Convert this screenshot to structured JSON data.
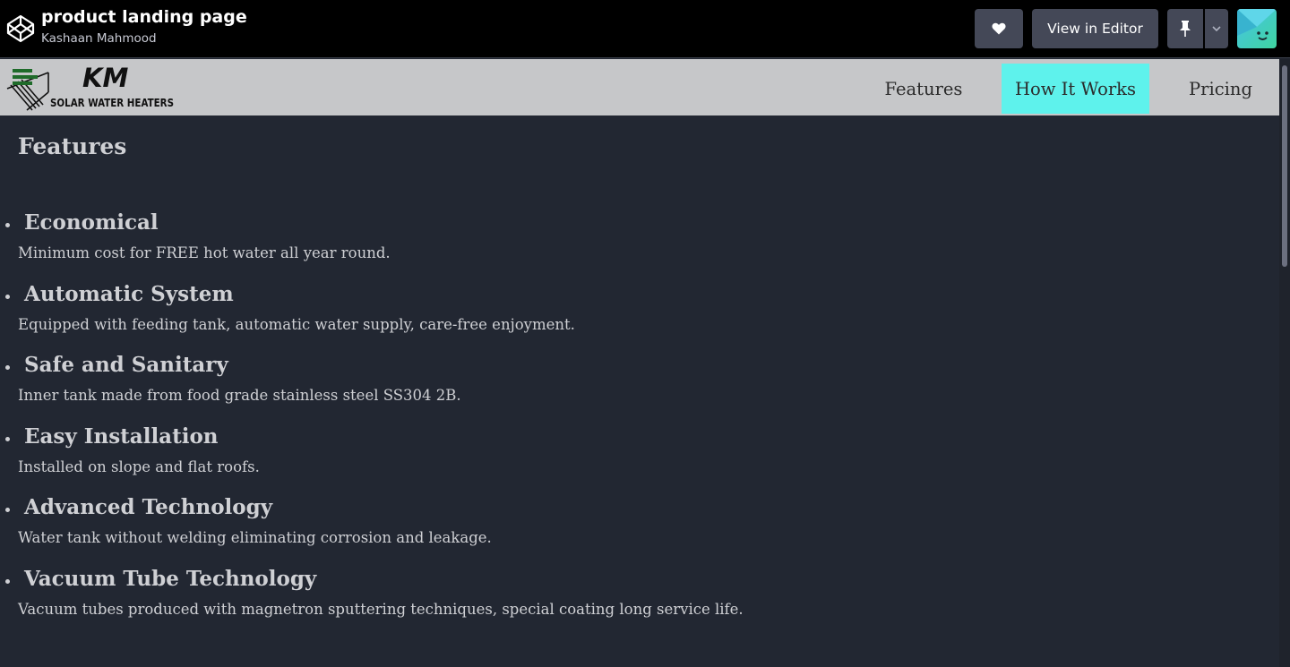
{
  "pen": {
    "title": "product landing page",
    "author": "Kashaan Mahmood",
    "view_in_editor_label": "View in Editor",
    "icons": {
      "logo": "codepen-logo-icon",
      "heart": "heart-icon",
      "pin": "pin-icon",
      "dropdown": "chevron-down-icon"
    }
  },
  "site": {
    "logo": {
      "brand": "KM",
      "tagline": "SOLAR WATER HEATERS"
    },
    "nav": [
      {
        "label": "Features"
      },
      {
        "label": "How It Works",
        "highlighted": true
      },
      {
        "label": "Pricing"
      }
    ],
    "features_title": "Features",
    "features": [
      {
        "heading": "Economical",
        "description": "Minimum cost for FREE hot water all year round."
      },
      {
        "heading": "Automatic System",
        "description": "Equipped with feeding tank, automatic water supply, care-free enjoyment."
      },
      {
        "heading": "Safe and Sanitary",
        "description": "Inner tank made from food grade stainless steel SS304 2B."
      },
      {
        "heading": "Easy Installation",
        "description": "Installed on slope and flat roofs."
      },
      {
        "heading": "Advanced Technology",
        "description": "Water tank without welding eliminating corrosion and leakage."
      },
      {
        "heading": "Vacuum Tube Technology",
        "description": "Vacuum tubes produced with magnetron sputtering techniques, special coating long service life."
      }
    ]
  },
  "colors": {
    "topbar": "#000000",
    "button": "#444857",
    "page_bg": "#222732",
    "header_bg": "#c6c7c9",
    "nav_highlight": "#5ef2ec",
    "text": "#cfd0d4"
  }
}
